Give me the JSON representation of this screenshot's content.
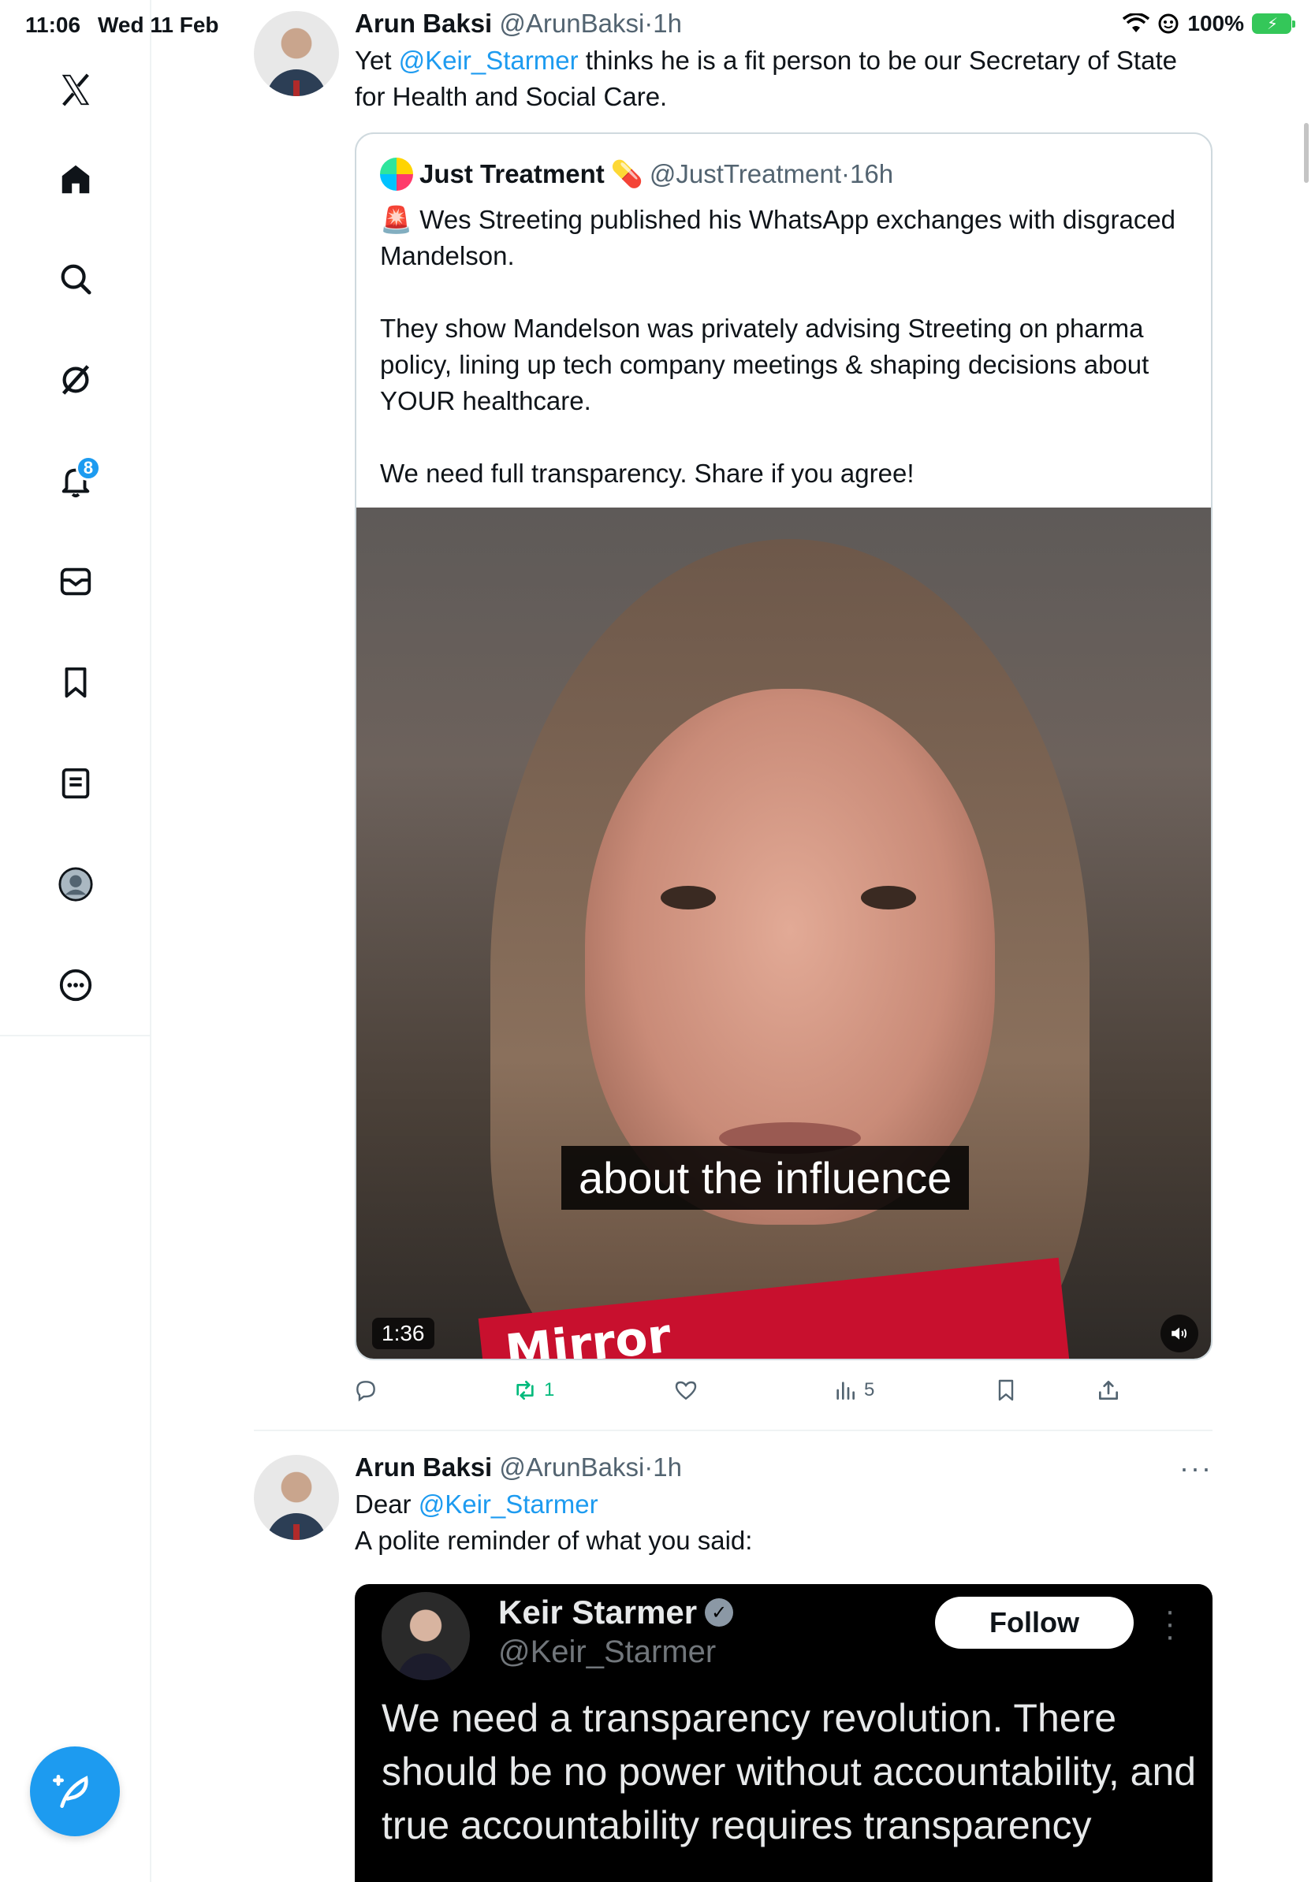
{
  "status_bar": {
    "time": "11:06",
    "date": "Wed 11 Feb",
    "battery": "100%"
  },
  "sidebar": {
    "items": [
      {
        "icon": "x-logo-icon"
      },
      {
        "icon": "home-icon"
      },
      {
        "icon": "search-icon"
      },
      {
        "icon": "grok-icon"
      },
      {
        "icon": "bell-icon",
        "badge": "8"
      },
      {
        "icon": "mail-icon"
      },
      {
        "icon": "bookmark-icon"
      },
      {
        "icon": "list-icon"
      },
      {
        "icon": "profile-icon"
      },
      {
        "icon": "more-icon"
      }
    ],
    "compose_icon": "compose-icon"
  },
  "tweet1": {
    "name": "Arun Baksi",
    "handle": "@ArunBaksi",
    "dot": "·",
    "time": "1h",
    "text_before": "Yet ",
    "mention": "@Keir_Starmer",
    "text_after": " thinks he is a fit person to be our Secretary of State for Health and Social Care.",
    "quote": {
      "name": "Just Treatment",
      "emoji": "💊",
      "handle": "@JustTreatment",
      "dot": "·",
      "time": "16h",
      "siren": "🚨",
      "p1": " Wes Streeting published his WhatsApp exchanges with disgraced Mandelson.",
      "p2": "They show Mandelson was privately advising Streeting on pharma policy, lining up tech company meetings & shaping decisions about YOUR healthcare.",
      "p3": "We need full transparency. Share if you agree!",
      "video": {
        "caption": "about the influence",
        "brand": "Mirror",
        "duration": "1:36"
      }
    },
    "actions": {
      "reposts": "1",
      "views": "5"
    }
  },
  "tweet2": {
    "name": "Arun Baksi",
    "handle": "@ArunBaksi",
    "dot": "·",
    "time": "1h",
    "more": "···",
    "line1_prefix": "Dear ",
    "mention": "@Keir_Starmer",
    "line2": "A polite reminder of what you said:",
    "embedded": {
      "name": "Keir Starmer",
      "handle": "@Keir_Starmer",
      "follow_label": "Follow",
      "text": "We need a transparency revolution. There should be no power without accountability, and true accountability requires transparency"
    }
  }
}
